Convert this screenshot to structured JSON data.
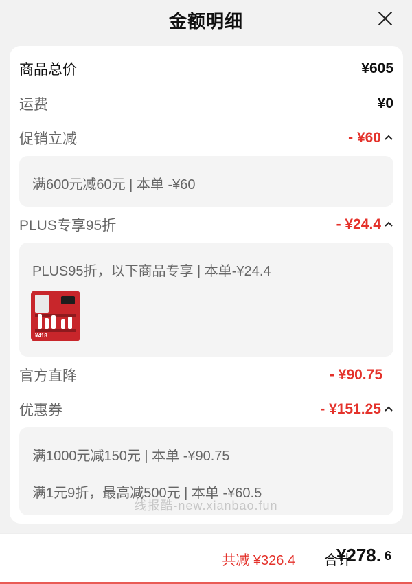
{
  "header": {
    "title": "金额明细",
    "close_icon": "close-icon"
  },
  "rows": {
    "goods_total": {
      "label": "商品总价",
      "value": "¥605"
    },
    "shipping": {
      "label": "运费",
      "value": "¥0"
    },
    "promo": {
      "label": "促销立减",
      "value": "- ¥60",
      "detail": "满600元减60元 | 本单 -¥60"
    },
    "plus": {
      "label": "PLUS专享95折",
      "value": "- ¥24.4",
      "detail": "PLUS95折，以下商品专享 | 本单-¥24.4",
      "thumb_price": "¥418"
    },
    "official": {
      "label": "官方直降",
      "value": "- ¥90.75"
    },
    "coupon": {
      "label": "优惠券",
      "value": "- ¥151.25",
      "detail_1": "满1000元减150元 | 本单 -¥90.75",
      "detail_2": "满1元9折，最高减500元 | 本单 -¥60.5"
    }
  },
  "watermark": "线报酷-new.xianbao.fun",
  "footer": {
    "total_discount": "共减 ¥326.4",
    "total_label": "合计",
    "total_amount": "¥278.",
    "total_decimal": "6"
  },
  "colors": {
    "accent": "#e4322b",
    "background": "#f2f2f2",
    "card": "#ffffff"
  }
}
